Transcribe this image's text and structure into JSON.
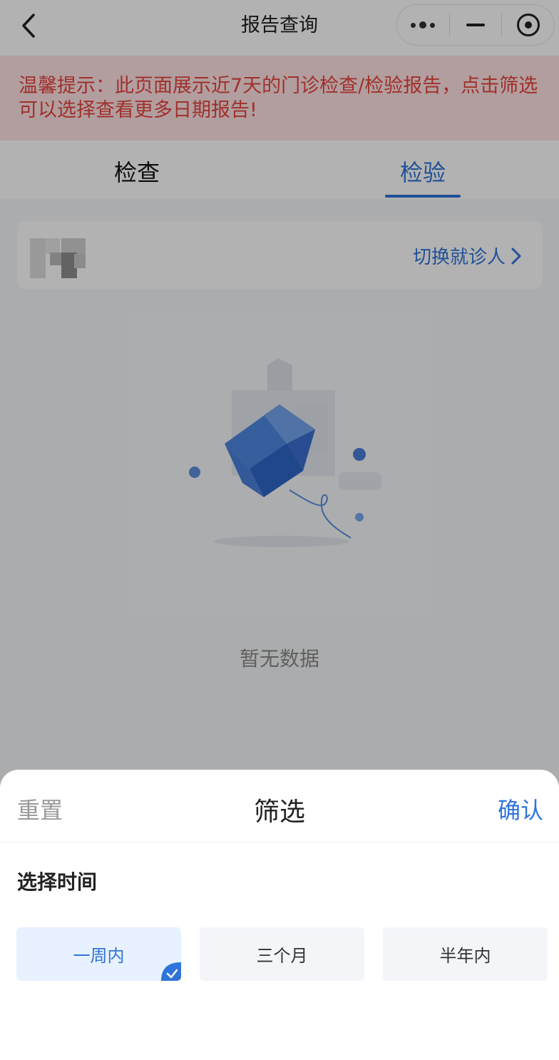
{
  "navbar": {
    "title": "报告查询",
    "back_icon": "chevron-left-icon",
    "more_icon": "more-dots-icon",
    "minimize_icon": "minimize-icon",
    "close_icon": "target-circle-icon"
  },
  "tip": {
    "text": "温馨提示：此页面展示近7天的门诊检查/检验报告，点击筛选可以选择查看更多日期报告!",
    "color": "#e5453f",
    "bg": "#ffe3e3"
  },
  "tabs": [
    {
      "label": "检查",
      "active": false
    },
    {
      "label": "检验",
      "active": true
    }
  ],
  "patient": {
    "switch_label": "切换就诊人"
  },
  "empty": {
    "text": "暂无数据"
  },
  "filter_sheet": {
    "reset_label": "重置",
    "title": "筛选",
    "confirm_label": "确认",
    "section_title": "选择时间",
    "options": [
      {
        "label": "一周内",
        "selected": true
      },
      {
        "label": "三个月",
        "selected": false
      },
      {
        "label": "半年内",
        "selected": false
      }
    ]
  },
  "colors": {
    "accent": "#2f74d9",
    "mask": "rgba(0,0,0,0.30)"
  }
}
